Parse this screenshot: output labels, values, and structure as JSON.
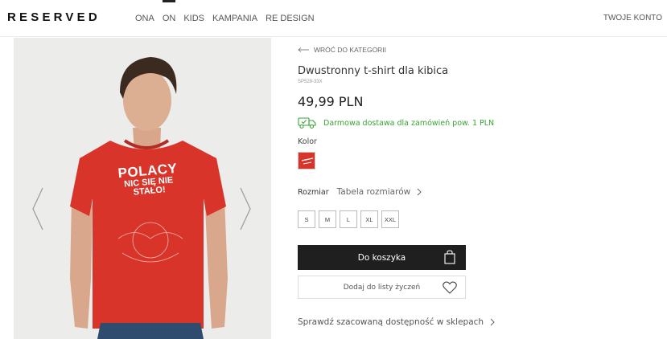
{
  "header": {
    "logo": "RESERVED",
    "nav": [
      {
        "label": "ONA"
      },
      {
        "label": "ON"
      },
      {
        "label": "KIDS"
      },
      {
        "label": "KAMPANIA"
      },
      {
        "label": "RE DESIGN"
      }
    ],
    "account": "TWOJE KONTO"
  },
  "gallery": {
    "shirt_text_line1": "POLACY",
    "shirt_text_line2": "NIC SIĘ NIE",
    "shirt_text_line3": "STAŁO!",
    "shirt_color": "#d9342a",
    "prev_icon": "chevron-left-icon",
    "next_icon": "chevron-right-icon"
  },
  "product": {
    "back_label": "WRÓĆ DO KATEGORII",
    "title": "Dwustronny t-shirt dla kibica",
    "sku": "SP528-33X",
    "price": "49,99 PLN",
    "delivery_text": "Darmowa dostawa dla zamówień pow. 1 PLN",
    "delivery_color": "#3aa335",
    "color_label": "Kolor",
    "size_label": "Rozmiar",
    "size_table_label": "Tabela rozmiarów",
    "sizes": [
      "S",
      "M",
      "L",
      "XL",
      "XXL"
    ],
    "cart_label": "Do koszyka",
    "wishlist_label": "Dodaj do listy życzeń",
    "stores_label": "Sprawdź szacowaną dostępność w sklepach"
  }
}
